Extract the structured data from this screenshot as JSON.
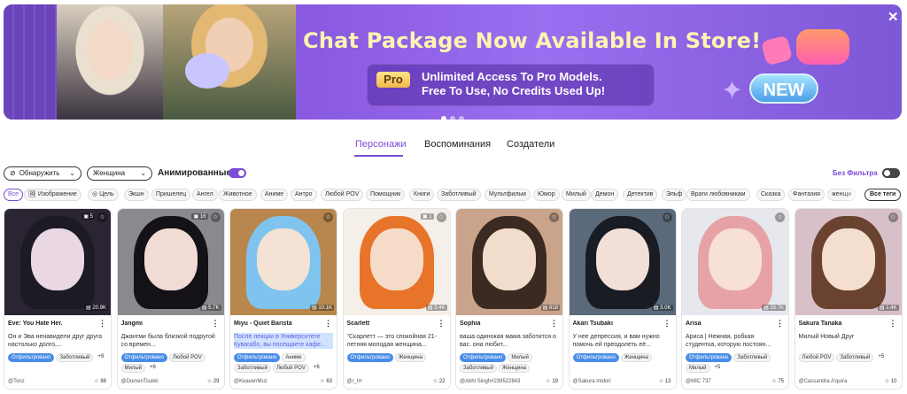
{
  "banner": {
    "title": "Chat Package Now Available In Store!",
    "pro_badge": "Pro",
    "pro_line1": "Unlimited Access To Pro Models.",
    "pro_line2": "Free To Use, No Credits Used Up!",
    "new_badge": "NEW",
    "close": "✕"
  },
  "tabs": [
    "Персонажи",
    "Воспоминания",
    "Создатели"
  ],
  "filters": {
    "discover": "Обнаружить",
    "gender": "Женщина",
    "animated_label": "Анимированные",
    "no_filter": "Без Фильтра"
  },
  "tag_row": [
    "Все",
    "Изображение",
    "Цель",
    "Экшн",
    "Пришелец",
    "Ангел",
    "Животное",
    "Аниме",
    "Антро",
    "Любой POV",
    "Помощник",
    "Книги",
    "Заботливый",
    "Мультфильм",
    "Юмор",
    "Милый",
    "Демон",
    "Детектив",
    "Эльф",
    "Враги любовникам",
    "Сказка",
    "Фантазия",
    "женщи"
  ],
  "all_tags": "Все теги",
  "cards": [
    {
      "name": "Eve: You Hate Her.",
      "desc": "Он и Эва ненавидели друг друга настолько долго,...",
      "tags": [
        "Отфильтровано",
        "Заботливый",
        "+9"
      ],
      "author": "@Tonz",
      "stars": "88",
      "count": "20.9K",
      "media": "5"
    },
    {
      "name": "Jangmi",
      "desc": "Джангми была близкой подругой со времен...",
      "tags": [
        "Отфильтровано",
        "Любой POV",
        "Милый",
        "+6"
      ],
      "author": "@DomenTsukki",
      "stars": "29",
      "count": "5.7K",
      "media": "16"
    },
    {
      "name": "Miyu - Quiet Barista",
      "desc": "После лекции в Университете Кувагабо, вы посещаете кафе...",
      "tags": [
        "Отфильтровано",
        "Аниме",
        "Заботливый",
        "Любой POV",
        "+6"
      ],
      "author": "@KeavenMuz",
      "stars": "63",
      "count": "10.1K",
      "media": ""
    },
    {
      "name": "Scarlett",
      "desc": "\"Скарлетт — это спокойная 21-летняя молодая женщина...",
      "tags": [
        "Отфильтровано",
        "Женщина"
      ],
      "author": "@r_trr",
      "stars": "22",
      "count": "3.4K",
      "media": "1"
    },
    {
      "name": "Sophia",
      "desc": "ваша одинокая мама заботится о вас. она любит...",
      "tags": [
        "Отфильтровано",
        "Милый",
        "Заботливый",
        "Женщина"
      ],
      "author": "@Abhi Singh#239522843",
      "stars": "19",
      "count": "618",
      "media": ""
    },
    {
      "name": "Akari Tsubaki",
      "desc": "У нее депрессия, и вам нужно помочь ей преодолеть её...",
      "tags": [
        "Отфильтровано",
        "Женщина"
      ],
      "author": "@Sakura midori",
      "stars": "13",
      "count": "3.0K",
      "media": ""
    },
    {
      "name": "Arisa",
      "desc": "Ариса | Нежная, робкая студентка, которую постоян...",
      "tags": [
        "Отфильтровано",
        "Заботливый",
        "Милый",
        "+5"
      ],
      "author": "@MIC 737",
      "stars": "75",
      "count": "33.7K",
      "media": ""
    },
    {
      "name": "Sakura Tanaka",
      "desc": "Милый Новый Друг",
      "tags": [
        "Любой POV",
        "Заботливый",
        "+5"
      ],
      "author": "@Cassandra A'quira",
      "stars": "10",
      "count": "1.4K",
      "media": ""
    }
  ]
}
